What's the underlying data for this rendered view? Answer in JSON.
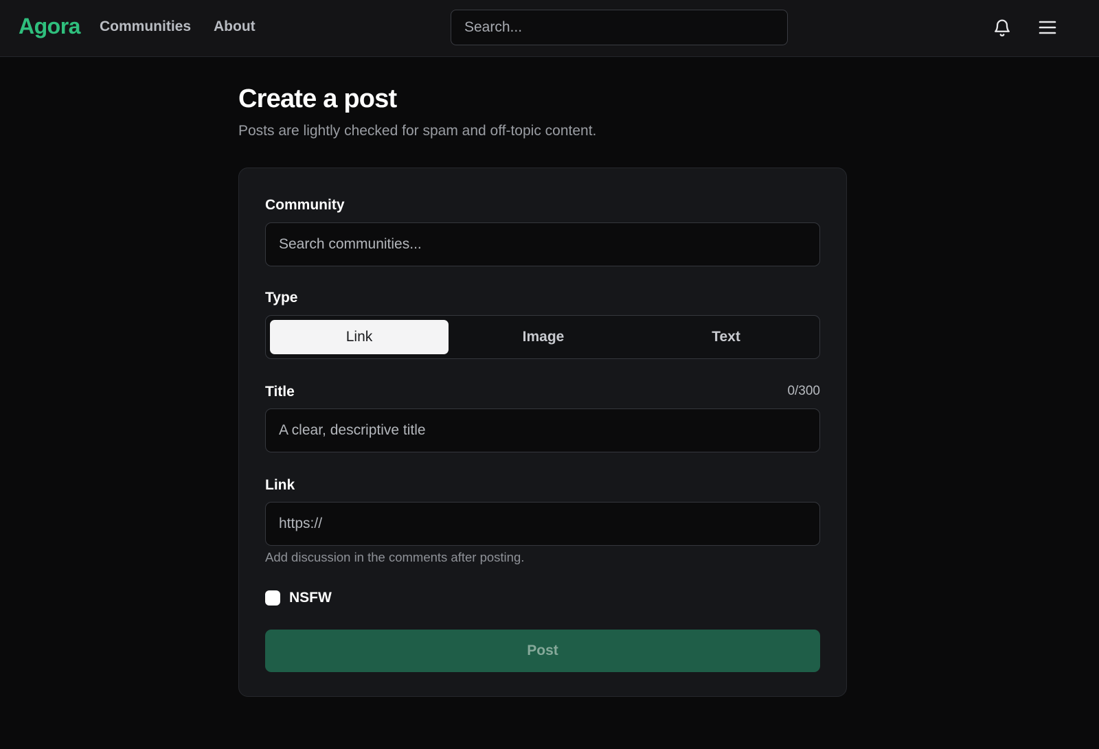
{
  "nav": {
    "brand": "Agora",
    "links": [
      {
        "label": "Communities"
      },
      {
        "label": "About"
      }
    ],
    "search_placeholder": "Search...",
    "icons": {
      "notifications": "bell-icon",
      "menu": "hamburger-menu-icon"
    }
  },
  "page": {
    "title": "Create a post",
    "subtitle": "Posts are lightly checked for spam and off-topic content."
  },
  "form": {
    "community": {
      "label": "Community",
      "placeholder": "Search communities...",
      "value": ""
    },
    "type": {
      "label": "Type",
      "options": [
        "Link",
        "Image",
        "Text"
      ],
      "selected": "Link"
    },
    "title": {
      "label": "Title",
      "counter": "0/300",
      "placeholder": "A clear, descriptive title",
      "value": ""
    },
    "link": {
      "label": "Link",
      "placeholder": "https://",
      "value": "",
      "hint": "Add discussion in the comments after posting."
    },
    "nsfw": {
      "label": "NSFW",
      "checked": false
    },
    "submit_label": "Post"
  },
  "colors": {
    "brand": "#2fbf7d",
    "background": "#0a0a0b",
    "card": "#16171a",
    "submit": "#1f5e48"
  }
}
